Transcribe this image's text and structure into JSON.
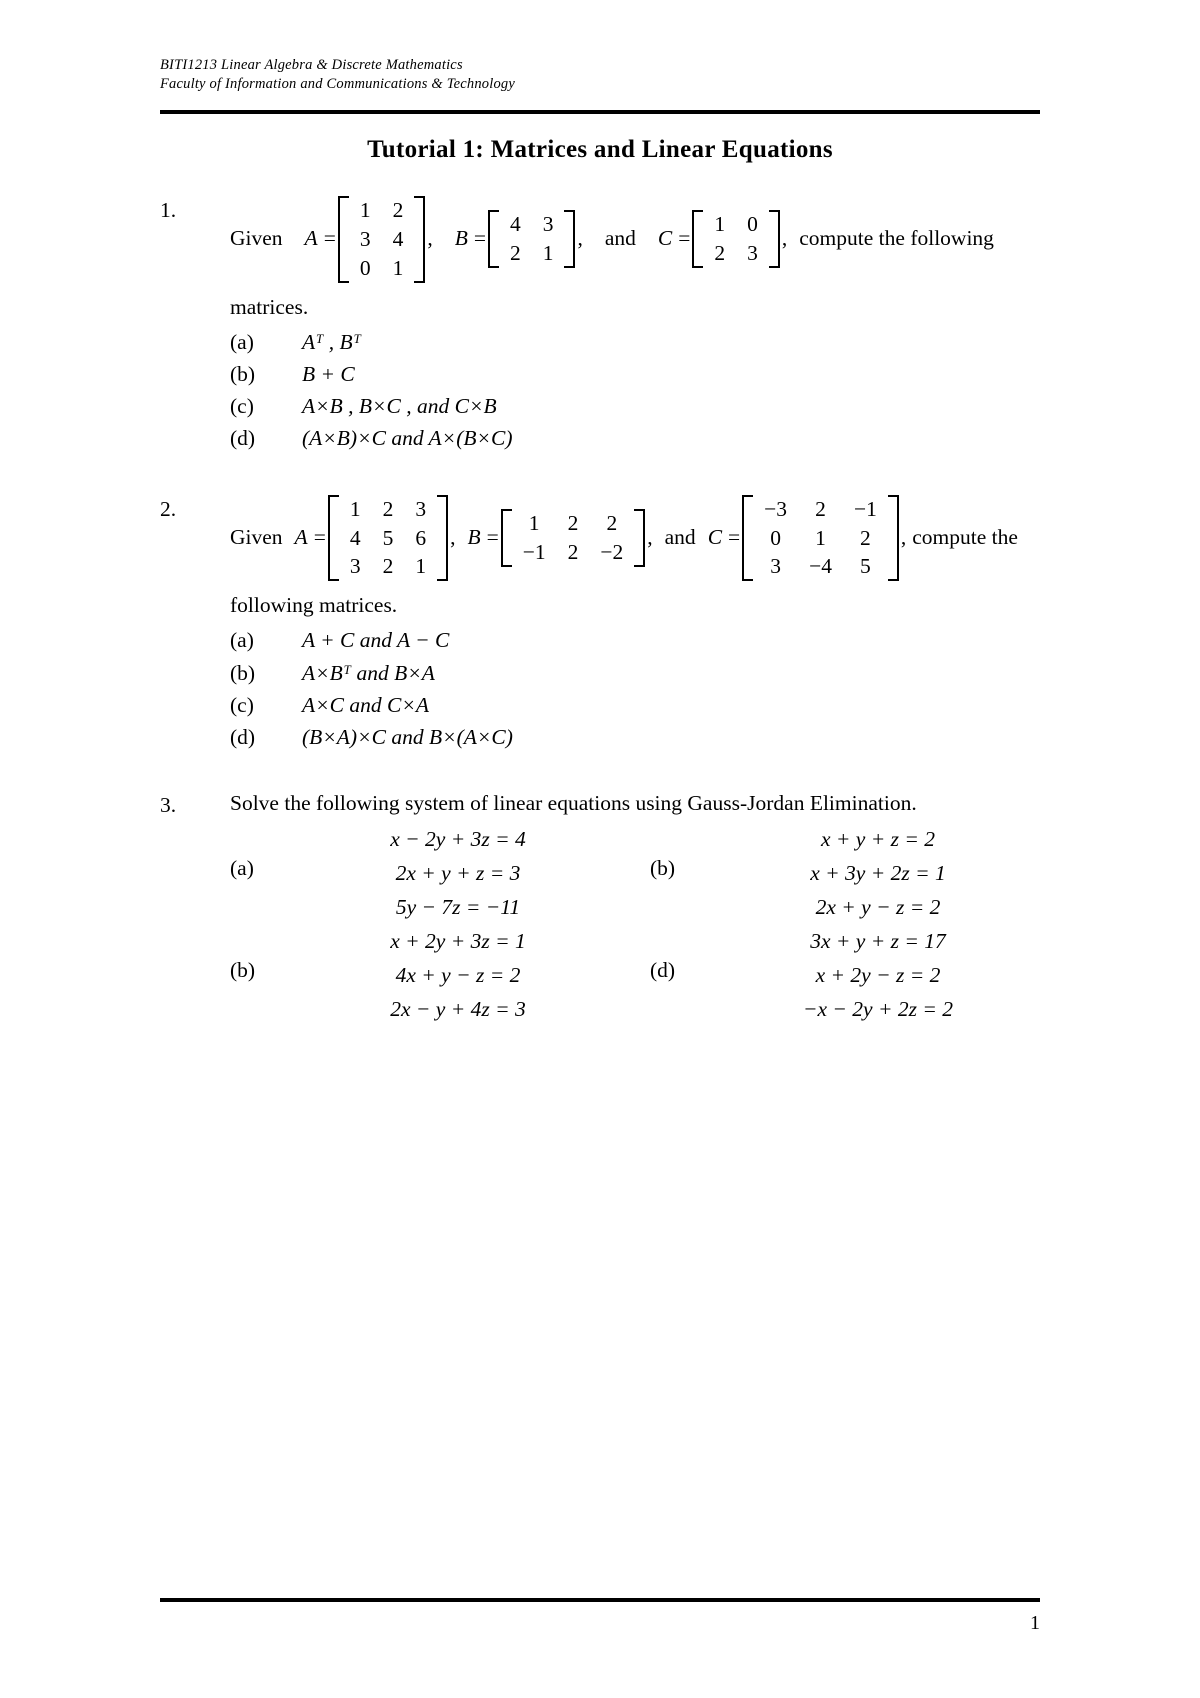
{
  "header": {
    "line1": "BITI1213 Linear Algebra & Discrete Mathematics",
    "line2": "Faculty of Information and Communications & Technology"
  },
  "title": "Tutorial 1: Matrices and Linear Equations",
  "questions": [
    {
      "number": "1.",
      "given_word": "Given",
      "a_label": "A",
      "equals": "=",
      "b_label": "B",
      "c_label": "C",
      "comma": ",",
      "and_word": "and",
      "tail": "compute  the  following",
      "tail2": "matrices.",
      "matrix_a": [
        [
          "1",
          "2"
        ],
        [
          "3",
          "4"
        ],
        [
          "0",
          "1"
        ]
      ],
      "matrix_b": [
        [
          "4",
          "3"
        ],
        [
          "2",
          "1"
        ]
      ],
      "matrix_c": [
        [
          "1",
          "0"
        ],
        [
          "2",
          "3"
        ]
      ],
      "items": [
        {
          "label": "(a)",
          "expr": "Aᵀ , Bᵀ"
        },
        {
          "label": "(b)",
          "expr": "B + C"
        },
        {
          "label": "(c)",
          "expr": "A×B ,  B×C , and  C×B"
        },
        {
          "label": "(d)",
          "expr": "(A×B)×C  and  A×(B×C)"
        }
      ]
    },
    {
      "number": "2.",
      "given_word": "Given",
      "a_label": "A",
      "equals": "=",
      "b_label": "B",
      "c_label": "C",
      "comma": ",",
      "and_word": "and",
      "tail": "compute the",
      "tail2": "following matrices.",
      "matrix_a": [
        [
          "1",
          "2",
          "3"
        ],
        [
          "4",
          "5",
          "6"
        ],
        [
          "3",
          "2",
          "1"
        ]
      ],
      "matrix_b": [
        [
          "1",
          "2",
          "2"
        ],
        [
          "−1",
          "2",
          "−2"
        ]
      ],
      "matrix_c": [
        [
          "−3",
          "2",
          "−1"
        ],
        [
          "0",
          "1",
          "2"
        ],
        [
          "3",
          "−4",
          "5"
        ]
      ],
      "items": [
        {
          "label": "(a)",
          "expr": "A + C  and  A − C"
        },
        {
          "label": "(b)",
          "expr": "A×Bᵀ  and  B×A"
        },
        {
          "label": "(c)",
          "expr": "A×C  and  C×A"
        },
        {
          "label": "(d)",
          "expr": "(B×A)×C  and  B×(A×C)"
        }
      ]
    }
  ],
  "question3": {
    "number": "3.",
    "prompt": "Solve the following system of linear equations using Gauss-Jordan Elimination.",
    "systems": [
      {
        "label": "(a)",
        "equations": [
          "x − 2y + 3z = 4",
          "2x + y + z = 3",
          "5y − 7z = −11"
        ]
      },
      {
        "label": "(b)",
        "equations": [
          "x + y + z = 2",
          "x + 3y + 2z = 1",
          "2x + y − z = 2"
        ]
      },
      {
        "label": "(b)",
        "equations": [
          "x + 2y + 3z = 1",
          "4x + y − z = 2",
          "2x − y + 4z = 3"
        ]
      },
      {
        "label": "(d)",
        "equations": [
          "3x + y + z = 17",
          "x + 2y − z = 2",
          "−x − 2y + 2z = 2"
        ]
      }
    ]
  },
  "footer": {
    "page_number": "1"
  }
}
